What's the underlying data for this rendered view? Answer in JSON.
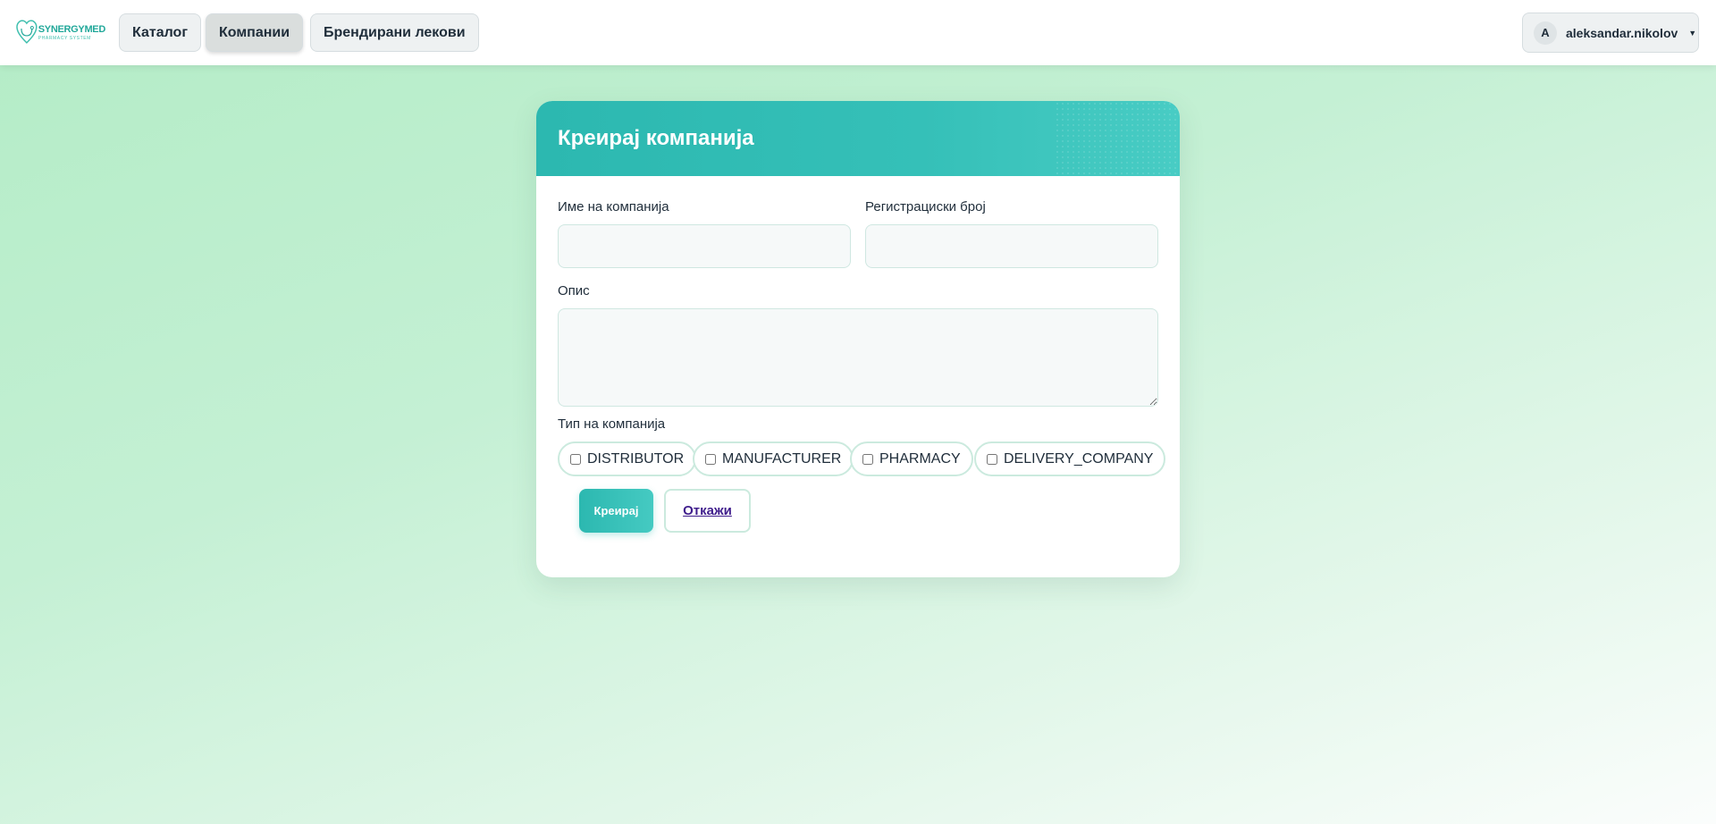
{
  "brand": {
    "name": "SYNERGYMED",
    "tagline": "PHARMACY SYSTEM"
  },
  "nav": {
    "items": [
      {
        "label": "Каталог",
        "active": false
      },
      {
        "label": "Компании",
        "active": true
      },
      {
        "label": "Брендирани лекови",
        "active": false
      }
    ]
  },
  "user": {
    "initial": "A",
    "username": "aleksandar.nikolov"
  },
  "form": {
    "title": "Креирај компанија",
    "company_name_label": "Име на компанија",
    "company_name_value": "",
    "registration_label": "Регистрациски број",
    "registration_value": "",
    "description_label": "Опис",
    "description_value": "",
    "type_label": "Тип на компанија",
    "types": [
      {
        "label": "DISTRIBUTOR",
        "checked": false
      },
      {
        "label": "MANUFACTURER",
        "checked": false
      },
      {
        "label": "PHARMACY",
        "checked": false
      },
      {
        "label": "DELIVERY_COMPANY",
        "checked": false
      }
    ],
    "submit_label": "Креирај",
    "cancel_label": "Откажи"
  },
  "colors": {
    "accent": "#2cb8b0",
    "header_gradient_end": "#48ccc4",
    "background_top": "#b3ecc6",
    "cancel_text": "#3f1d8c"
  }
}
